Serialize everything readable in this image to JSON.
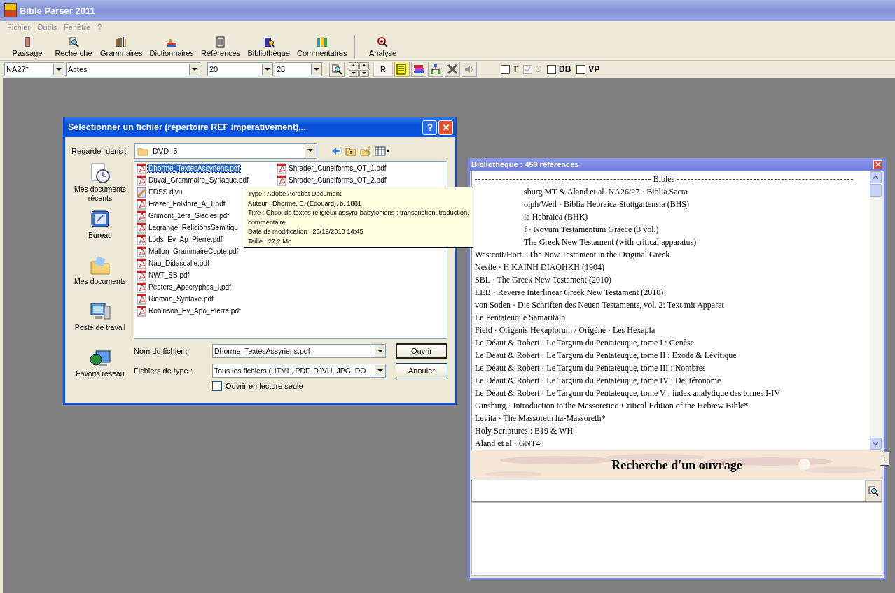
{
  "window": {
    "title": "Bible Parser 2011"
  },
  "menu": [
    {
      "label": "Fichier",
      "disabled": true
    },
    {
      "label": "Outils",
      "disabled": true
    },
    {
      "label": "Fenêtre",
      "disabled": true
    },
    {
      "label": "?",
      "disabled": true
    }
  ],
  "toolbar": [
    {
      "label": "Passage",
      "kind": "book"
    },
    {
      "label": "Recherche",
      "kind": "search"
    },
    {
      "label": "Grammaires",
      "kind": "books"
    },
    {
      "label": "Dictionnaires",
      "kind": "stack"
    },
    {
      "label": "Références",
      "kind": "scroll"
    },
    {
      "label": "Bibliothèque",
      "kind": "library"
    },
    {
      "label": "Commentaires",
      "kind": "notes"
    },
    {
      "label": "Analyse",
      "kind": "analyse"
    }
  ],
  "selectors": [
    {
      "value": "NA27*",
      "kind": "version"
    },
    {
      "value": "Actes",
      "kind": "book"
    },
    {
      "value": "20",
      "kind": "chapter"
    },
    {
      "value": "28",
      "kind": "verse"
    }
  ],
  "r_button": "R",
  "options": [
    {
      "label": "T",
      "checked": false,
      "disabled": false
    },
    {
      "label": "C",
      "checked": true,
      "disabled": true
    },
    {
      "label": "DB",
      "checked": false,
      "disabled": false
    },
    {
      "label": "VP",
      "checked": false,
      "disabled": false
    }
  ],
  "dialog": {
    "title": "Sélectionner un fichier (répertoire REF impérativement)...",
    "look_in_label": "Regarder dans :",
    "look_in": "DVD_5",
    "places": [
      {
        "label": "Mes documents récents",
        "kind": "recent"
      },
      {
        "label": "Bureau",
        "kind": "desktop"
      },
      {
        "label": "Mes documents",
        "kind": "documents"
      },
      {
        "label": "Poste de travail",
        "kind": "computer"
      },
      {
        "label": "Favoris réseau",
        "kind": "network"
      }
    ],
    "files": [
      {
        "name": "Dhorme_TextesAssyriens.pdf",
        "kind": "pdf",
        "selected": true
      },
      {
        "name": "Duval_Grammaire_Syriaque.pdf",
        "kind": "pdf",
        "selected": false
      },
      {
        "name": "EDSS.djvu",
        "kind": "djvu",
        "selected": false
      },
      {
        "name": "Frazer_Folklore_A_T.pdf",
        "kind": "pdf",
        "selected": false
      },
      {
        "name": "Grimont_1ers_Siecles.pdf",
        "kind": "pdf",
        "selected": false
      },
      {
        "name": "Lagrange_ReligionsSemitiqu",
        "kind": "pdf",
        "selected": false
      },
      {
        "name": "Lods_Ev_Ap_Pierre.pdf",
        "kind": "pdf",
        "selected": false
      },
      {
        "name": "Mallon_GrammaireCopte.pdf",
        "kind": "pdf",
        "selected": false
      },
      {
        "name": "Nau_Didascalie.pdf",
        "kind": "pdf",
        "selected": false
      },
      {
        "name": "NWT_SB.pdf",
        "kind": "pdf",
        "selected": false
      },
      {
        "name": "Peeters_Apocryphes_I.pdf",
        "kind": "pdf",
        "selected": false
      },
      {
        "name": "Rieman_Syntaxe.pdf",
        "kind": "pdf",
        "selected": false
      },
      {
        "name": "Robinson_Ev_Apo_Pierre.pdf",
        "kind": "pdf",
        "selected": false
      },
      {
        "name": "Shrader_Cuneiforms_OT_1.pdf",
        "kind": "pdf",
        "selected": false
      },
      {
        "name": "Shrader_Cuneiforms_OT_2.pdf",
        "kind": "pdf",
        "selected": false
      }
    ],
    "filename_label": "Nom du fichier :",
    "filename": "Dhorme_TextesAssyriens.pdf",
    "filetype_label": "Fichiers de type :",
    "filetype": "Tous les fichiers (HTML, PDF, DJVU, JPG, DO",
    "readonly": {
      "label": "Ouvrir en lecture seule",
      "checked": false
    },
    "buttons": [
      "Ouvrir",
      "Annuler"
    ]
  },
  "tooltip": [
    "Type : Adobe Acrobat Document",
    "Auteur : Dhorme, E. (Edouard), b. 1881",
    "Titre : Choix de textes religieux assyro-babyloniens : transcription, traduction,",
    "commentaire",
    "Date de modification : 25/12/2010 14:45",
    "Taille  : 27,2 Mo"
  ],
  "library": {
    "title": "Bibliothèque :  459 références",
    "section": "Bibles",
    "items": [
      {
        "text": "sburg MT & Aland et al. NA26/27 · Biblia Sacra",
        "clipped": true
      },
      {
        "text": "olph/Weil · Biblia Hebraica Stuttgartensia (BHS)",
        "clipped": true
      },
      {
        "text": "ia Hebraica (BHK)",
        "clipped": true
      },
      {
        "text": "f · Novum Testamentum Graece (3 vol.)",
        "clipped": true
      },
      {
        "text": "The Greek New Testament (with critical apparatus)",
        "clipped": true
      },
      {
        "text": "Westcott/Hort · The New Testament in the Original Greek",
        "clipped": false
      },
      {
        "text": "Nestle · H KAINH DIAQHKH (1904)",
        "clipped": false
      },
      {
        "text": "SBL · The Greek New Testament (2010)",
        "clipped": false
      },
      {
        "text": "LEB · Reverse Interlinear Greek New Testament (2010)",
        "clipped": false
      },
      {
        "text": "von Soden · Die Schriften des Neuen Testaments, vol. 2: Text mit Apparat",
        "clipped": false
      },
      {
        "text": "Le Pentateuque Samaritain",
        "clipped": false
      },
      {
        "text": "Field · Origenis Hexaplorum / Origène · Les Hexapla",
        "clipped": false
      },
      {
        "text": "Le Déaut & Robert · Le Targum du Pentateuque, tome I : Genèse",
        "clipped": false
      },
      {
        "text": "Le Déaut & Robert · Le Targum du Pentateuque, tome II : Exode & Lévitique",
        "clipped": false
      },
      {
        "text": "Le Déaut & Robert · Le Targum du Pentateuque, tome III : Nombres",
        "clipped": false
      },
      {
        "text": "Le Déaut & Robert · Le Targum du Pentateuque, tome IV : Deutéronome",
        "clipped": false
      },
      {
        "text": "Le Déaut & Robert · Le Targum du Pentateuque, tome V : index analytique des tomes I-IV",
        "clipped": false
      },
      {
        "text": "Ginsburg · Introduction to the Massoretico-Critical Edition of the Hebrew Bible*",
        "clipped": false
      },
      {
        "text": "Levita · The Massoreth ha-Massoreth*",
        "clipped": false
      },
      {
        "text": "Holy Scriptures : B19 & WH",
        "clipped": false
      },
      {
        "text": "Aland et al · GNT4",
        "clipped": false
      }
    ],
    "expand": "+",
    "search_title": "Recherche d'un ouvrage"
  }
}
